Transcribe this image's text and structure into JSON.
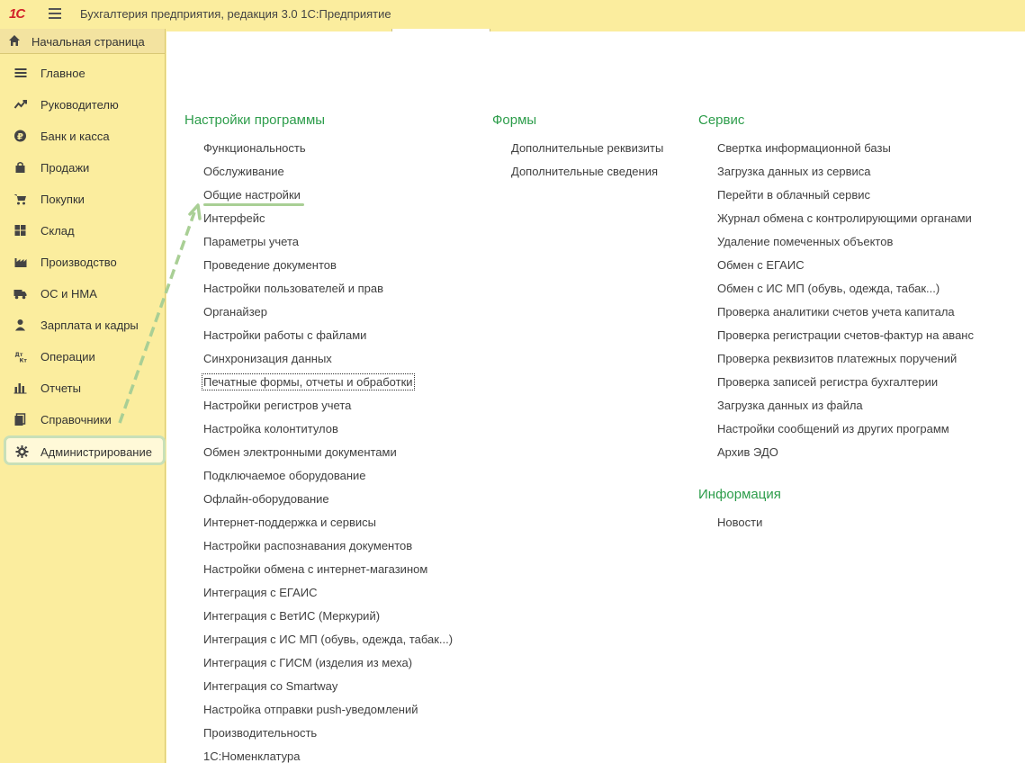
{
  "app": {
    "logo": "1С",
    "title": "Бухгалтерия предприятия, редакция 3.0 1С:Предприятие"
  },
  "sidebar": {
    "home_label": "Начальная страница",
    "items": [
      {
        "label": "Главное",
        "icon": "list-icon"
      },
      {
        "label": "Руководителю",
        "icon": "trend-icon"
      },
      {
        "label": "Банк и касса",
        "icon": "ruble-icon"
      },
      {
        "label": "Продажи",
        "icon": "bag-icon"
      },
      {
        "label": "Покупки",
        "icon": "cart-icon"
      },
      {
        "label": "Склад",
        "icon": "warehouse-icon"
      },
      {
        "label": "Производство",
        "icon": "factory-icon"
      },
      {
        "label": "ОС и НМА",
        "icon": "truck-icon"
      },
      {
        "label": "Зарплата и кадры",
        "icon": "person-icon"
      },
      {
        "label": "Операции",
        "icon": "dt-kt-icon"
      },
      {
        "label": "Отчеты",
        "icon": "bar-chart-icon"
      },
      {
        "label": "Справочники",
        "icon": "books-icon"
      },
      {
        "label": "Администрирование",
        "icon": "gear-icon",
        "active": true
      }
    ]
  },
  "sections": {
    "settings": {
      "title": "Настройки программы",
      "links": [
        "Функциональность",
        "Обслуживание",
        "Общие настройки",
        "Интерфейс",
        "Параметры учета",
        "Проведение документов",
        "Настройки пользователей и прав",
        "Органайзер",
        "Настройки работы с файлами",
        "Синхронизация данных",
        "Печатные формы, отчеты и обработки",
        "Настройки регистров учета",
        "Настройка колонтитулов",
        "Обмен электронными документами",
        "Подключаемое оборудование",
        "Офлайн-оборудование",
        "Интернет-поддержка и сервисы",
        "Настройки распознавания документов",
        "Настройки обмена с интернет-магазином",
        "Интеграция с ЕГАИС",
        "Интеграция с ВетИС (Меркурий)",
        "Интеграция с ИС МП (обувь, одежда, табак...)",
        "Интеграция с ГИСМ (изделия из меха)",
        "Интеграция со Smartway",
        "Настройка отправки push-уведомлений",
        "Производительность",
        "1С:Номенклатура"
      ]
    },
    "forms": {
      "title": "Формы",
      "links": [
        "Дополнительные реквизиты",
        "Дополнительные сведения"
      ]
    },
    "service": {
      "title": "Сервис",
      "links": [
        "Свертка информационной базы",
        "Загрузка данных из сервиса",
        "Перейти в облачный сервис",
        "Журнал обмена с контролирующими органами",
        "Удаление помеченных объектов",
        "Обмен с ЕГАИС",
        "Обмен с ИС МП (обувь, одежда, табак...)",
        "Проверка аналитики счетов учета капитала",
        "Проверка регистрации счетов-фактур на аванс",
        "Проверка реквизитов платежных поручений",
        "Проверка записей регистра бухгалтерии",
        "Загрузка данных из файла",
        "Настройки сообщений из других программ",
        "Архив ЭДО"
      ]
    },
    "info": {
      "title": "Информация",
      "links": [
        "Новости"
      ]
    }
  },
  "colors": {
    "panel_bg": "#fbed9e",
    "section_title": "#2d9d4b",
    "highlight": "#a9cf95"
  }
}
